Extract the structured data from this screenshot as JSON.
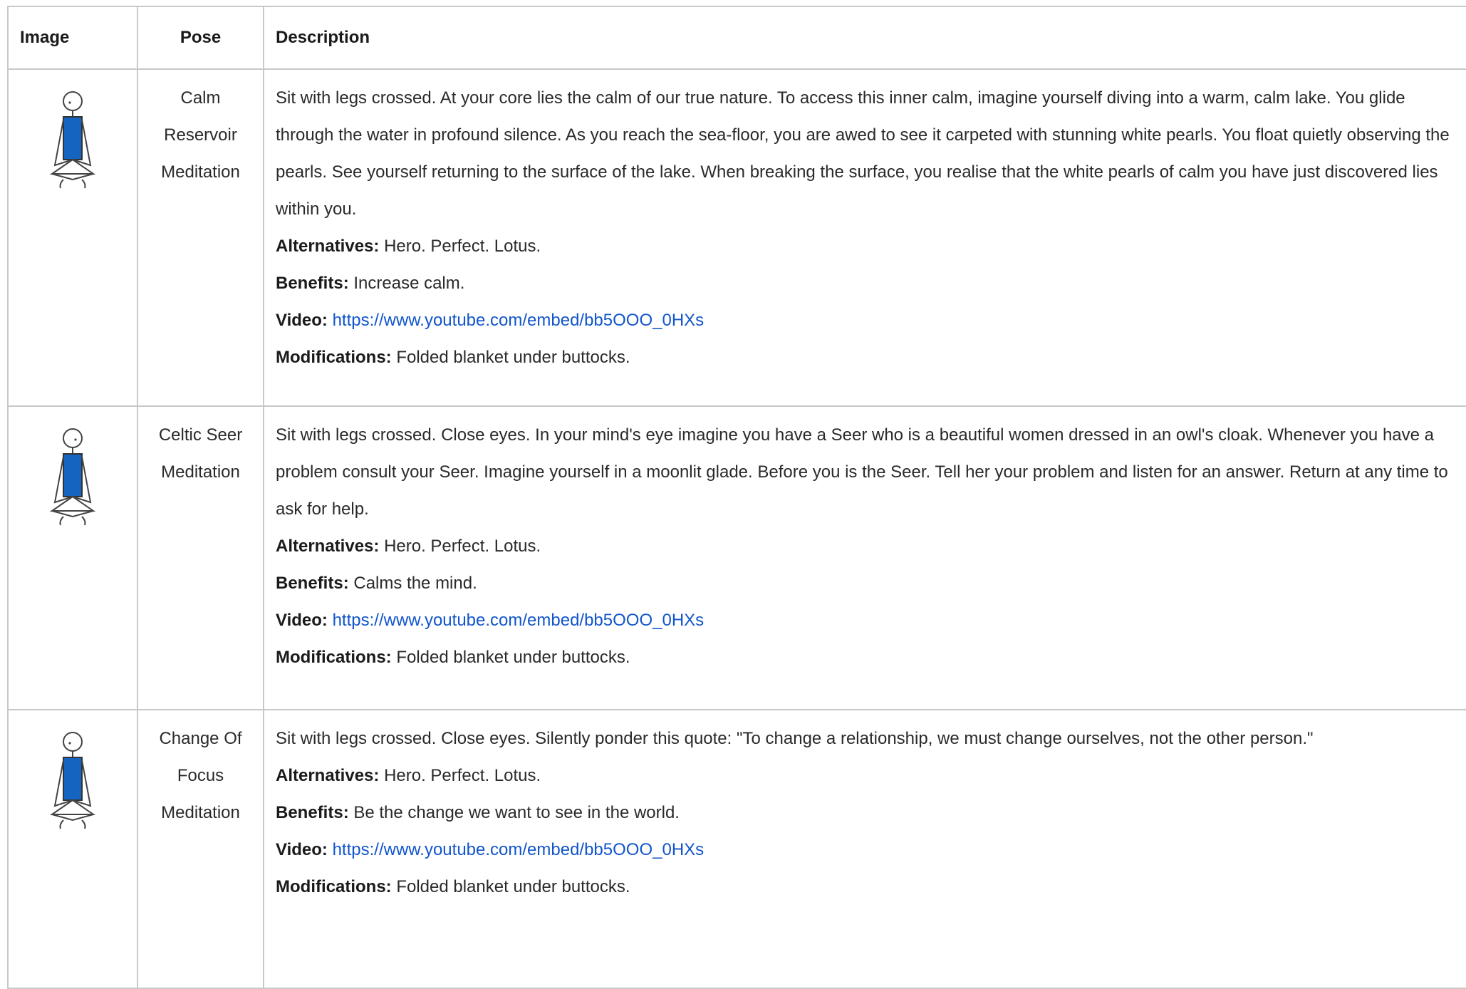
{
  "table": {
    "headers": {
      "image": "Image",
      "pose": "Pose",
      "description": "Description"
    },
    "labels": {
      "alternatives": "Alternatives:",
      "benefits": "Benefits:",
      "video": "Video:",
      "modifications": "Modifications:"
    },
    "rows": [
      {
        "image_icon": "seated-meditation-figure-icon",
        "pose": "Calm Reservoir Meditation",
        "description": "Sit with legs crossed. At your core lies the calm of our true nature. To access this inner calm, imagine yourself diving into a warm, calm lake. You glide through the water in profound silence. As you reach the sea-floor, you are awed to see it carpeted with stunning white pearls. You float quietly observing the pearls. See yourself returning to the surface of the lake. When breaking the surface, you realise that the white pearls of calm you have just discovered lies within you.",
        "alternatives": "Hero. Perfect. Lotus.",
        "benefits": "Increase calm.",
        "video": "https://www.youtube.com/embed/bb5OOO_0HXs",
        "modifications": "Folded blanket under buttocks."
      },
      {
        "image_icon": "seated-meditation-figure-icon",
        "pose": "Celtic Seer Meditation",
        "description": "Sit with legs crossed. Close eyes. In your mind's eye imagine you have a Seer who is a beautiful women dressed in an owl's cloak. Whenever you have a problem consult your Seer. Imagine yourself in a moonlit glade. Before you is the Seer. Tell her your problem and listen for an answer. Return at any time to ask for help.",
        "alternatives": "Hero. Perfect. Lotus.",
        "benefits": "Calms the mind.",
        "video": "https://www.youtube.com/embed/bb5OOO_0HXs",
        "modifications": "Folded blanket under buttocks."
      },
      {
        "image_icon": "seated-meditation-figure-icon",
        "pose": "Change Of Focus Meditation",
        "description": "Sit with legs crossed. Close eyes. Silently ponder this quote: \"To change a relationship, we must change ourselves, not the other person.\"",
        "alternatives": "Hero. Perfect. Lotus.",
        "benefits": "Be the change we want to see in the world.",
        "video": "https://www.youtube.com/embed/bb5OOO_0HXs",
        "modifications": "Folded blanket under buttocks."
      }
    ]
  },
  "colors": {
    "link": "#1155cc",
    "figure_body": "#1565c0",
    "border": "#c8c8c8"
  }
}
